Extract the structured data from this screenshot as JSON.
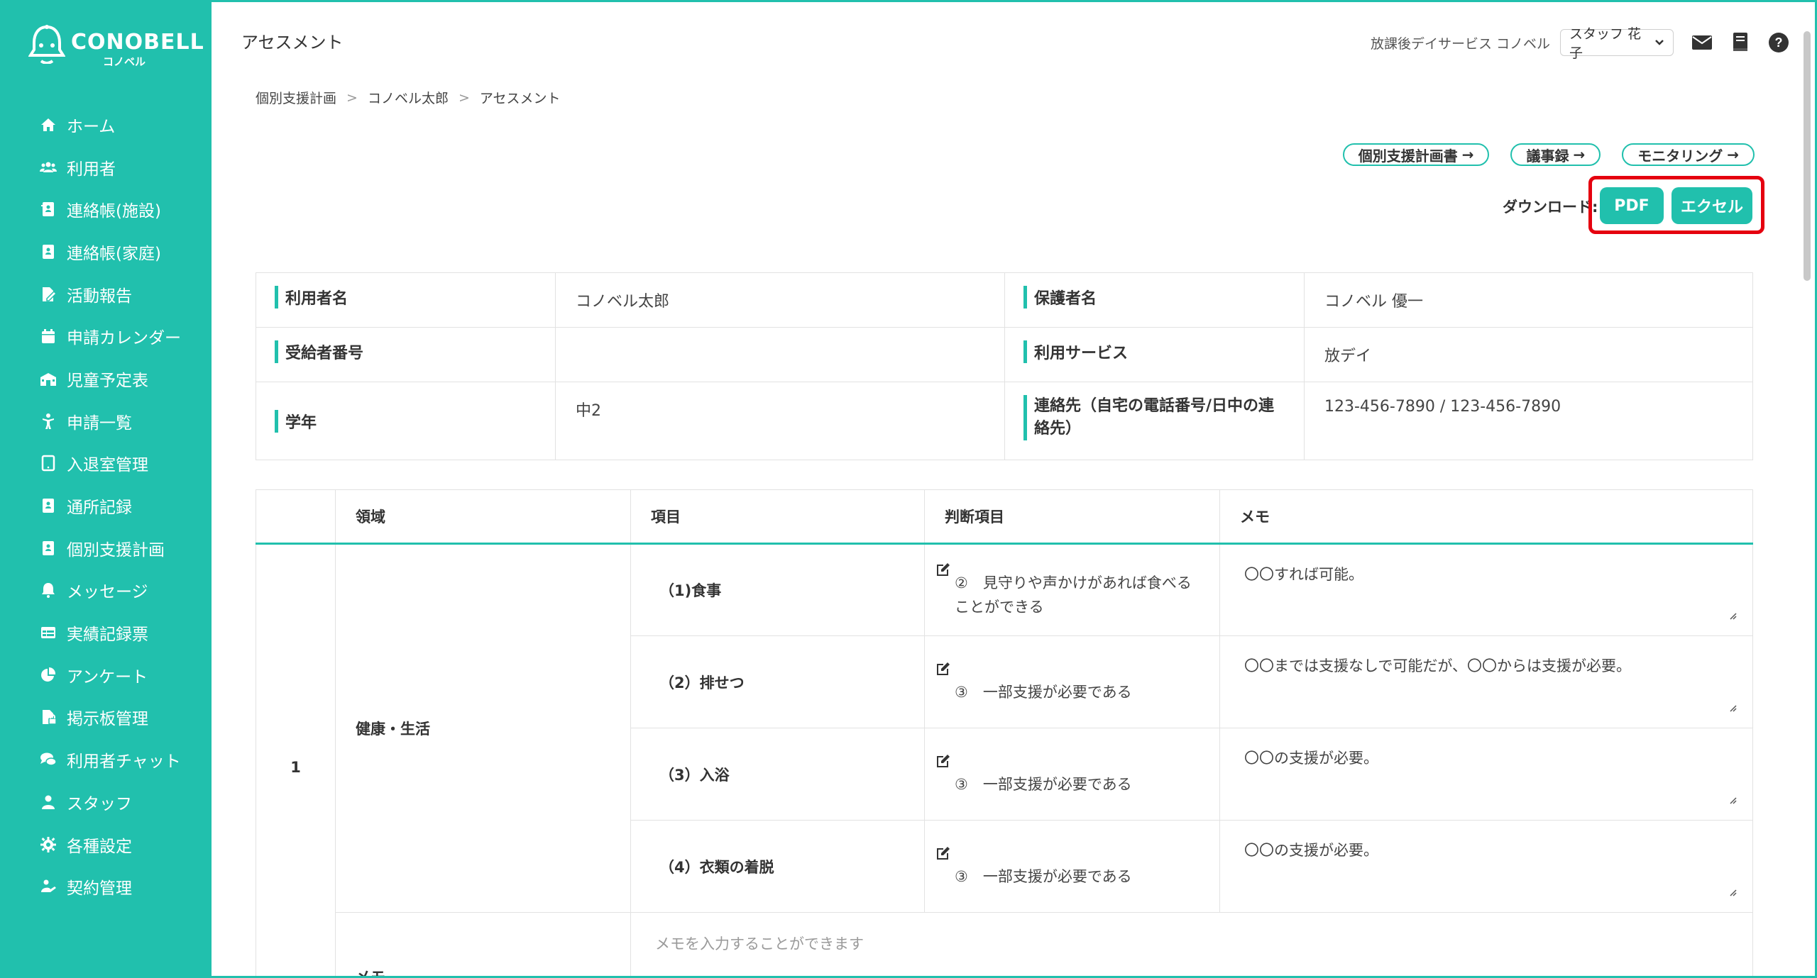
{
  "brand": {
    "name": "CONOBELL",
    "sub": "コノベル"
  },
  "sidebar": {
    "items": [
      {
        "label": "ホーム",
        "icon": "home-icon"
      },
      {
        "label": "利用者",
        "icon": "users-icon"
      },
      {
        "label": "連絡帳(施設)",
        "icon": "contact-book-icon"
      },
      {
        "label": "連絡帳(家庭)",
        "icon": "contact-book-icon"
      },
      {
        "label": "活動報告",
        "icon": "file-edit-icon"
      },
      {
        "label": "申請カレンダー",
        "icon": "calendar-icon"
      },
      {
        "label": "児童予定表",
        "icon": "school-icon"
      },
      {
        "label": "申請一覧",
        "icon": "child-icon"
      },
      {
        "label": "入退室管理",
        "icon": "tablet-icon"
      },
      {
        "label": "通所記録",
        "icon": "contact-book-icon"
      },
      {
        "label": "個別支援計画",
        "icon": "contact-book-icon"
      },
      {
        "label": "メッセージ",
        "icon": "bell-icon"
      },
      {
        "label": "実績記録票",
        "icon": "table-icon"
      },
      {
        "label": "アンケート",
        "icon": "pie-chart-icon"
      },
      {
        "label": "掲示板管理",
        "icon": "file-lock-icon"
      },
      {
        "label": "利用者チャット",
        "icon": "chat-icon"
      },
      {
        "label": "スタッフ",
        "icon": "staff-icon"
      },
      {
        "label": "各種設定",
        "icon": "gear-icon"
      },
      {
        "label": "契約管理",
        "icon": "contract-icon"
      }
    ]
  },
  "header": {
    "title": "アセスメント",
    "facility": "放課後デイサービス コノベル",
    "staff": "スタッフ 花子"
  },
  "breadcrumb": [
    "個別支援計画",
    "コノベル太郎",
    "アセスメント"
  ],
  "links": [
    "個別支援計画書",
    "議事録",
    "モニタリング"
  ],
  "download": {
    "label": "ダウンロード:",
    "pdf": "PDF",
    "excel": "エクセル"
  },
  "info": {
    "user_name_label": "利用者名",
    "user_name": "コノベル太郎",
    "guardian_label": "保護者名",
    "guardian": "コノベル 優一",
    "recipient_no_label": "受給者番号",
    "recipient_no": "",
    "service_label": "利用サービス",
    "service": "放デイ",
    "grade_label": "学年",
    "grade": "中2",
    "contact_label": "連絡先（自宅の電話番号/日中の連絡先）",
    "contact": "123-456-7890 / 123-456-7890"
  },
  "assessment": {
    "headers": [
      "",
      "領域",
      "項目",
      "判断項目",
      "メモ"
    ],
    "number": "1",
    "area": "健康・生活",
    "rows": [
      {
        "item": "（1)食事",
        "judge": "②　見守りや声かけがあれば食べることができる",
        "memo": "〇〇すれば可能。"
      },
      {
        "item": "（2）排せつ",
        "judge": "③　一部支援が必要である",
        "memo": "〇〇までは支援なしで可能だが、〇〇からは支援が必要。"
      },
      {
        "item": "（3）入浴",
        "judge": "③　一部支援が必要である",
        "memo": "〇〇の支援が必要。"
      },
      {
        "item": "（4）衣類の着脱",
        "judge": "③　一部支援が必要である",
        "memo": "〇〇の支援が必要。"
      }
    ],
    "memo_label": "メモ",
    "memo_placeholder": "メモを入力することができます"
  },
  "colors": {
    "accent": "#21c0ad",
    "highlight": "#e5000f"
  }
}
